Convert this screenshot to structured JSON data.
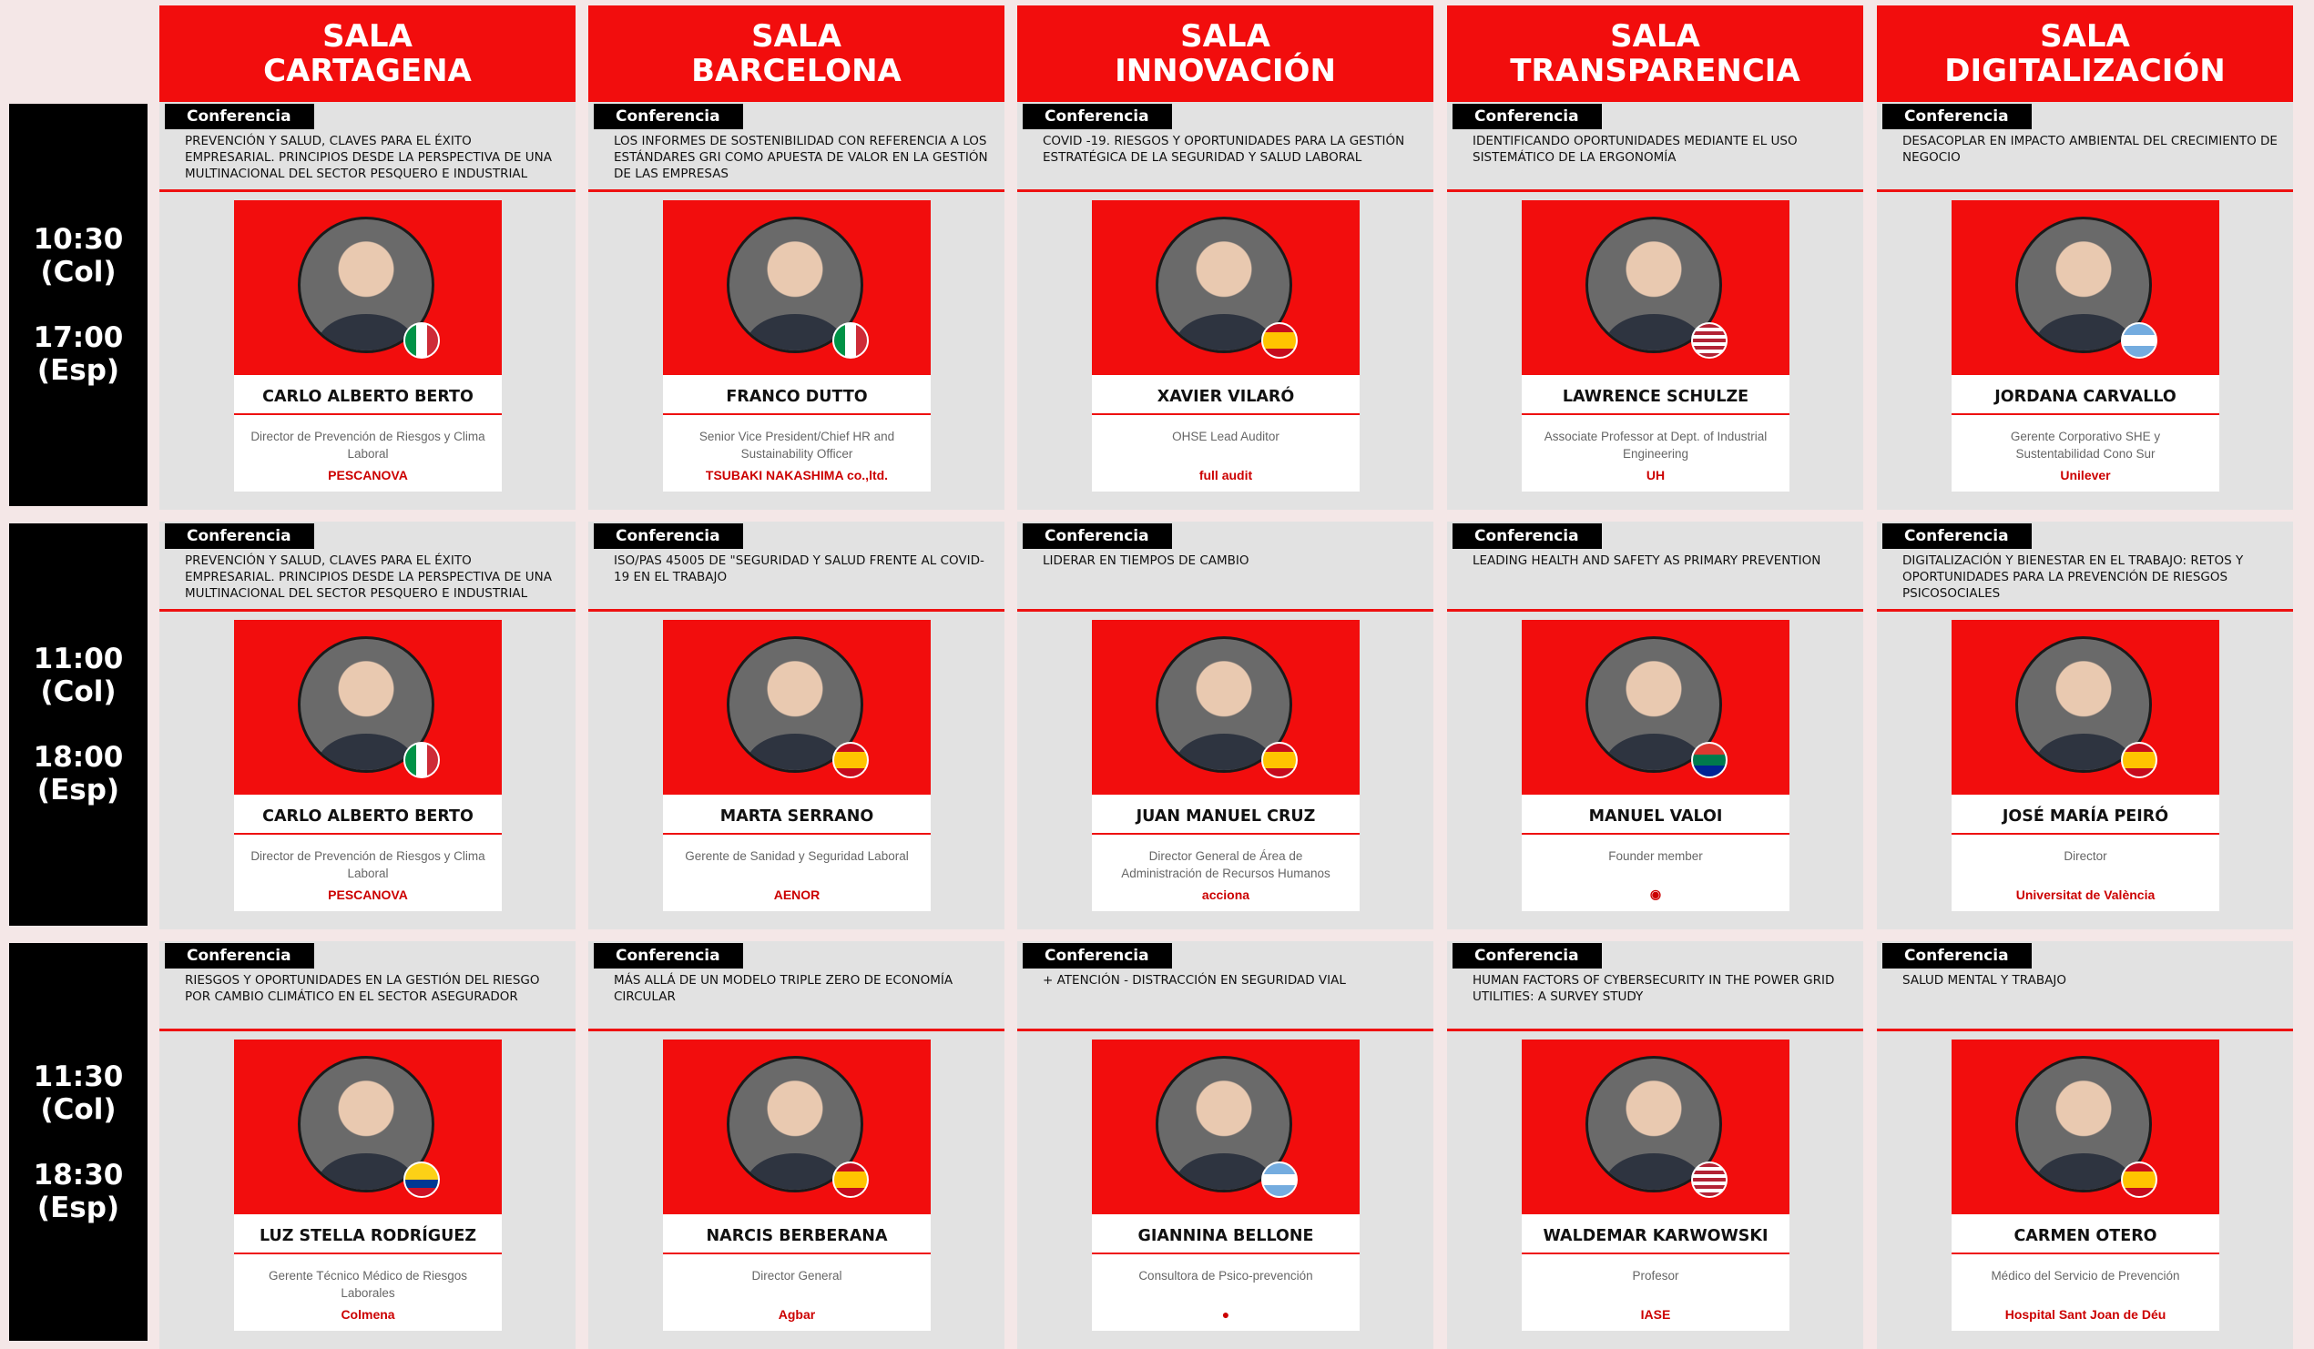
{
  "rooms": [
    {
      "line1": "SALA",
      "line2": "CARTAGENA"
    },
    {
      "line1": "SALA",
      "line2": "BARCELONA"
    },
    {
      "line1": "SALA",
      "line2": "INNOVACIÓN"
    },
    {
      "line1": "SALA",
      "line2": "TRANSPARENCIA"
    },
    {
      "line1": "SALA",
      "line2": "DIGITALIZACIÓN"
    }
  ],
  "slots": [
    {
      "col_time": "10:30",
      "col_zone": "(Col)",
      "esp_time": "17:00",
      "esp_zone": "(Esp)"
    },
    {
      "col_time": "11:00",
      "col_zone": "(Col)",
      "esp_time": "18:00",
      "esp_zone": "(Esp)"
    },
    {
      "col_time": "11:30",
      "col_zone": "(Col)",
      "esp_time": "18:30",
      "esp_zone": "(Esp)"
    }
  ],
  "badge_label": "Conferencia",
  "sessions": [
    [
      {
        "topic": "Prevención y salud, claves para el éxito empresarial. Principios desde la perspectiva de una multinacional del sector pesquero e industrial",
        "speaker": "CARLO ALBERTO BERTO",
        "role": "Director de Prevención de Riesgos y Clima Laboral",
        "logo": "PESCANOVA",
        "flag": "italy"
      },
      {
        "topic": "Los informes de sostenibilidad con referencia a los estándares GRI como apuesta de valor en la gestión de las empresas",
        "speaker": "FRANCO DUTTO",
        "role": "Senior Vice President/Chief HR and Sustainability Officer",
        "logo": "TSUBAKI NAKASHIMA co.,ltd.",
        "flag": "italy"
      },
      {
        "topic": "Covid -19. Riesgos y oportunidades para la gestión estratégica de la seguridad y salud laboral",
        "speaker": "XAVIER VILARÓ",
        "role": "OHSE Lead Auditor",
        "logo": "full audit",
        "flag": "spain"
      },
      {
        "topic": "Identificando oportunidades mediante el uso sistemático de la ergonomía",
        "speaker": "LAWRENCE SCHULZE",
        "role": "Associate Professor at Dept. of Industrial Engineering",
        "logo": "UH",
        "flag": "usa"
      },
      {
        "topic": "Desacoplar en impacto ambiental del crecimiento de negocio",
        "speaker": "JORDANA CARVALLO",
        "role": "Gerente Corporativo SHE y Sustentabilidad Cono Sur",
        "logo": "Unilever",
        "flag": "argentina"
      }
    ],
    [
      {
        "topic": "Prevención y salud, claves para el éxito empresarial. Principios desde la perspectiva de una multinacional del sector pesquero e industrial",
        "speaker": "CARLO ALBERTO BERTO",
        "role": "Director de Prevención de Riesgos y Clima Laboral",
        "logo": "PESCANOVA",
        "flag": "italy"
      },
      {
        "topic": "ISO/PAS 45005 de \"Seguridad y salud frente al COVID-19 en el trabajo",
        "speaker": "MARTA SERRANO",
        "role": "Gerente de Sanidad y Seguridad Laboral",
        "logo": "AENOR",
        "flag": "spain"
      },
      {
        "topic": "Liderar en tiempos de cambio",
        "speaker": "JUAN MANUEL CRUZ",
        "role": "Director General de Área de Administración de Recursos Humanos",
        "logo": "acciona",
        "flag": "spain"
      },
      {
        "topic": "Leading health and safety as primary prevention",
        "speaker": "MANUEL VALOI",
        "role": "Founder member",
        "logo": "◉",
        "flag": "southafrica"
      },
      {
        "topic": "Digitalización y bienestar en el trabajo: retos y oportunidades para la prevención de riesgos psicosociales",
        "speaker": "JOSÉ MARÍA PEIRÓ",
        "role": "Director",
        "logo": "Universitat de València",
        "flag": "spain"
      }
    ],
    [
      {
        "topic": "Riesgos y oportunidades en la gestión del riesgo por cambio climático en el sector asegurador",
        "speaker": "LUZ STELLA RODRÍGUEZ",
        "role": "Gerente Técnico Médico de Riesgos Laborales",
        "logo": "Colmena",
        "flag": "colombia"
      },
      {
        "topic": "Más allá de un modelo triple zero de economía circular",
        "speaker": "NARCIS BERBERANA",
        "role": "Director General",
        "logo": "Agbar",
        "flag": "spain"
      },
      {
        "topic": "+ Atención - Distracción en seguridad vial",
        "speaker": "GIANNINA BELLONE",
        "role": "Consultora de Psico-prevención",
        "logo": "●",
        "flag": "argentina"
      },
      {
        "topic": "Human factors of cybersecurity in the power grid utilities: a survey study",
        "speaker": "WALDEMAR KARWOWSKI",
        "role": "Profesor",
        "logo": "IASE",
        "flag": "usa"
      },
      {
        "topic": "Salud mental y trabajo",
        "speaker": "CARMEN OTERO",
        "role": "Médico del Servicio de Prevención",
        "logo": "Hospital Sant Joan de Déu",
        "flag": "spain"
      }
    ]
  ],
  "colors": {
    "accent": "#f20d0d",
    "cell_bg": "#e2e2e2",
    "time_bg": "#000000"
  }
}
